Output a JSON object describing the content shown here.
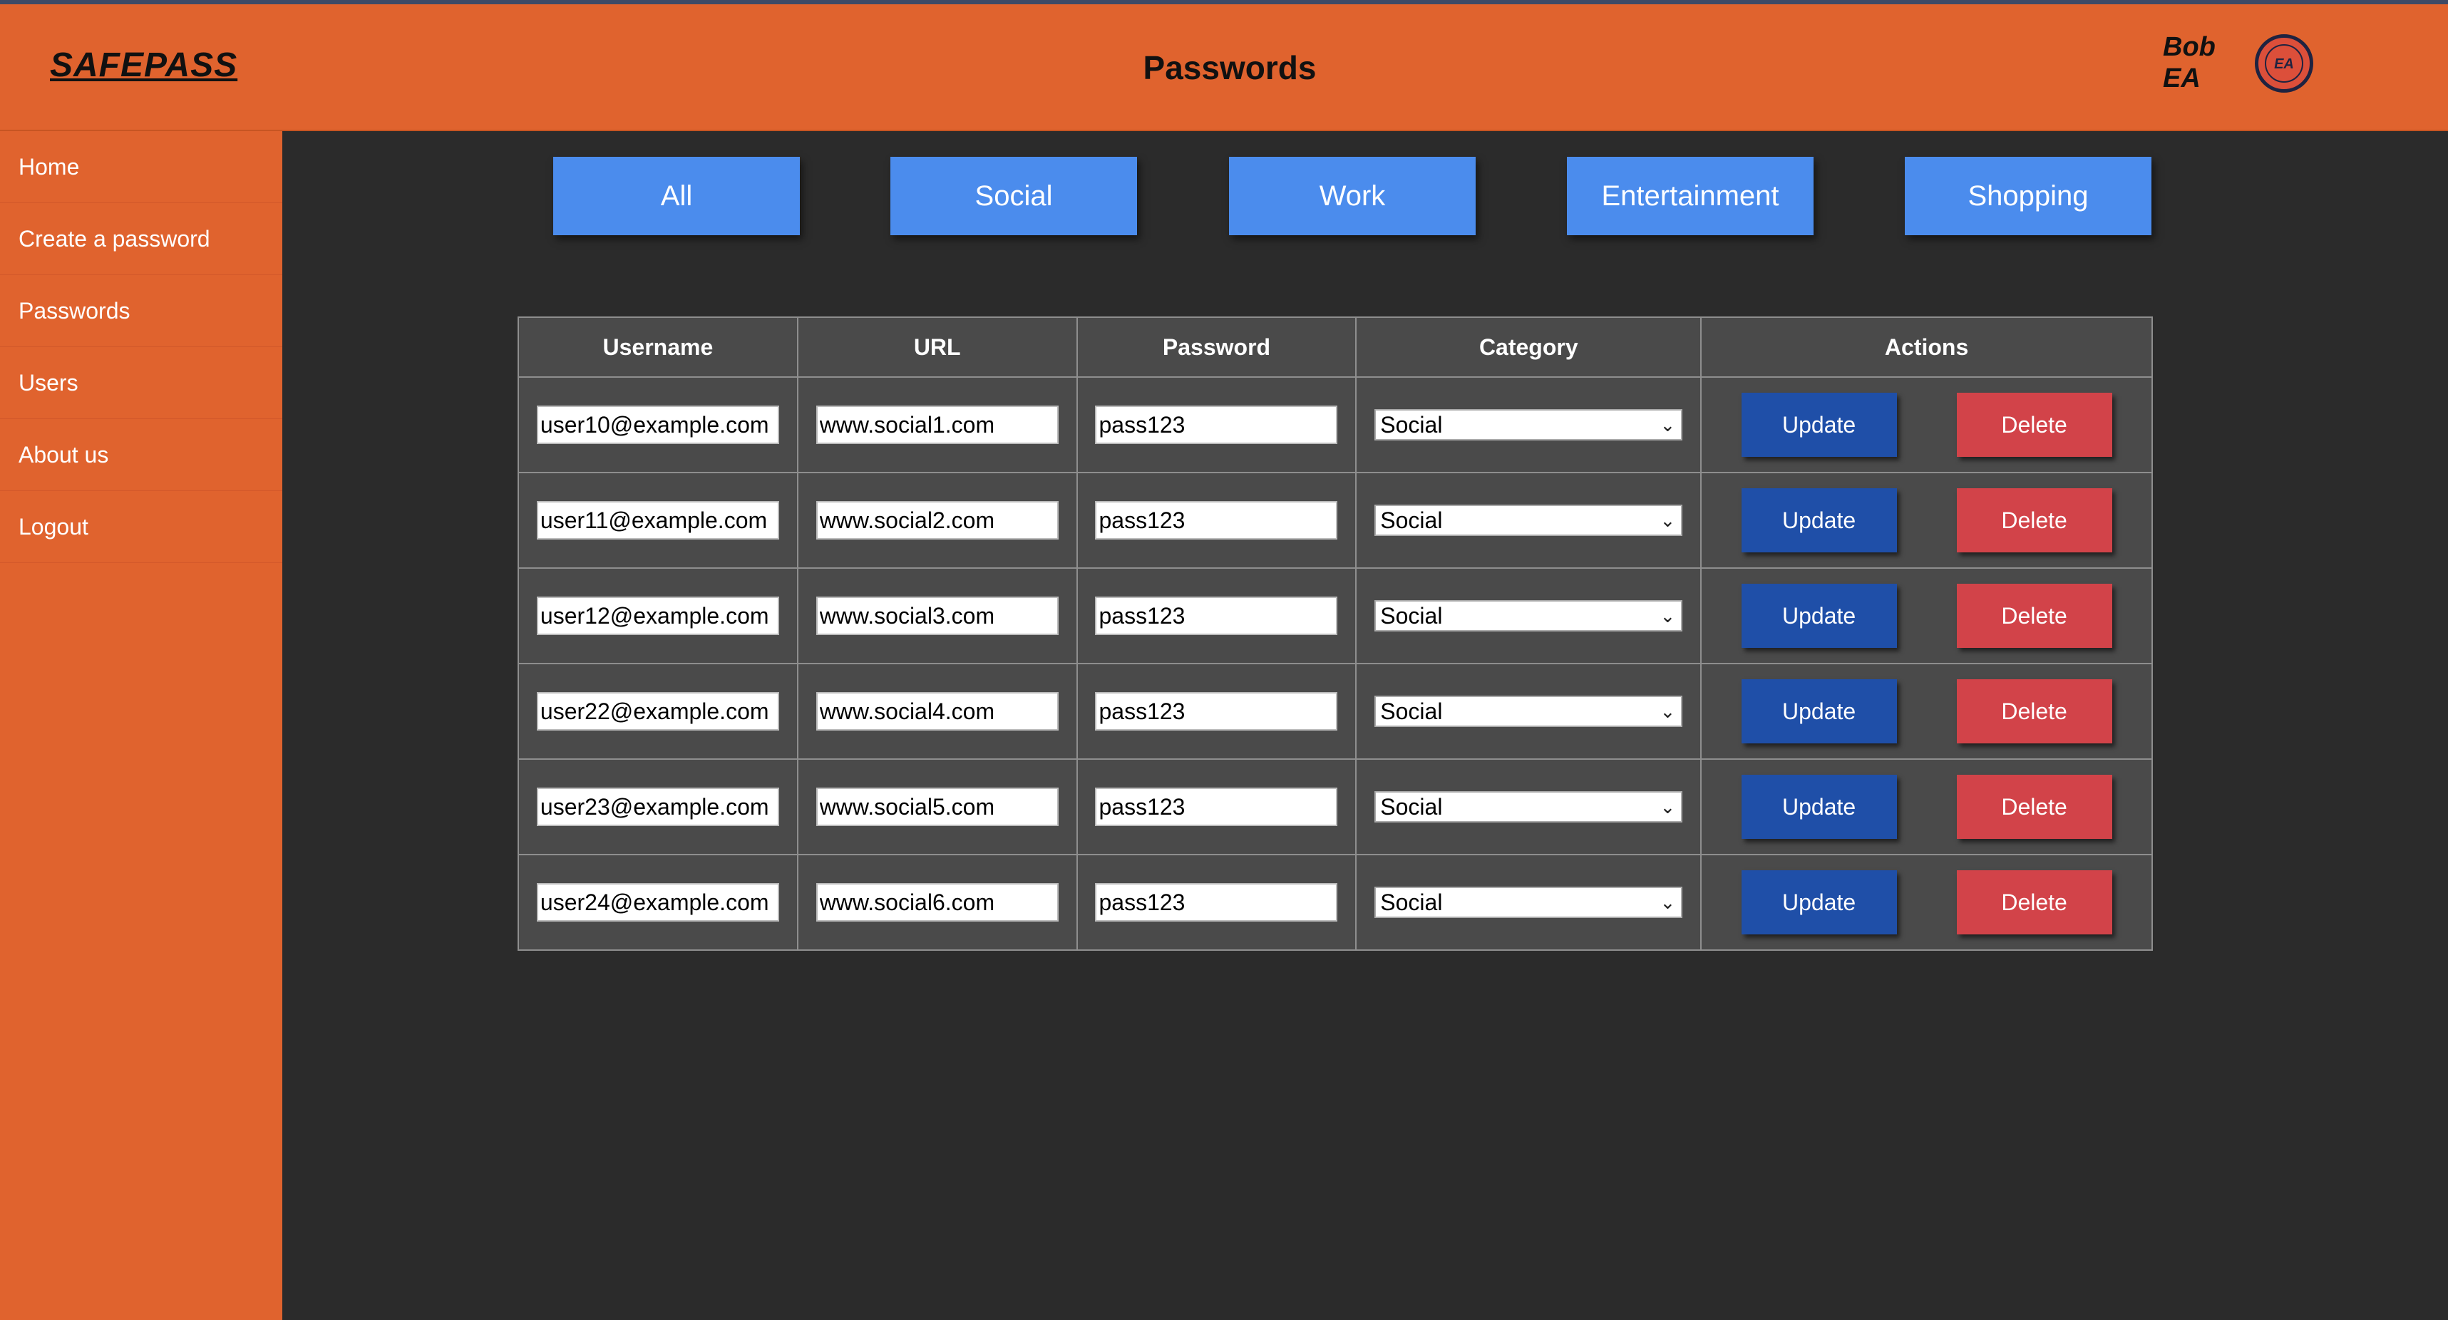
{
  "header": {
    "logo": "SAFEPASS",
    "title": "Passwords",
    "user_first": "Bob",
    "user_last": "EA",
    "avatar_initials": "EA"
  },
  "sidebar": {
    "items": [
      {
        "label": "Home"
      },
      {
        "label": "Create a password"
      },
      {
        "label": "Passwords"
      },
      {
        "label": "Users"
      },
      {
        "label": "About us"
      },
      {
        "label": "Logout"
      }
    ]
  },
  "filters": [
    {
      "label": "All"
    },
    {
      "label": "Social"
    },
    {
      "label": "Work"
    },
    {
      "label": "Entertainment"
    },
    {
      "label": "Shopping"
    }
  ],
  "table": {
    "headers": [
      "Username",
      "URL",
      "Password",
      "Category",
      "Actions"
    ],
    "update_label": "Update",
    "delete_label": "Delete",
    "rows": [
      {
        "username": "user10@example.com",
        "url": "www.social1.com",
        "password": "pass123",
        "category": "Social"
      },
      {
        "username": "user11@example.com",
        "url": "www.social2.com",
        "password": "pass123",
        "category": "Social"
      },
      {
        "username": "user12@example.com",
        "url": "www.social3.com",
        "password": "pass123",
        "category": "Social"
      },
      {
        "username": "user22@example.com",
        "url": "www.social4.com",
        "password": "pass123",
        "category": "Social"
      },
      {
        "username": "user23@example.com",
        "url": "www.social5.com",
        "password": "pass123",
        "category": "Social"
      },
      {
        "username": "user24@example.com",
        "url": "www.social6.com",
        "password": "pass123",
        "category": "Social"
      }
    ]
  },
  "colors": {
    "brand_orange": "#e0632e",
    "background_dark": "#2b2b2b",
    "filter_blue": "#4b8ced",
    "update_blue": "#1f4fa8",
    "delete_red": "#d24349"
  }
}
